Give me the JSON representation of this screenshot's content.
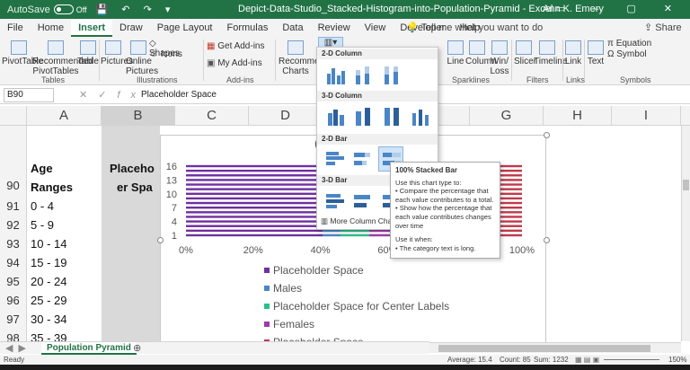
{
  "titlebar": {
    "autosave": "AutoSave",
    "autosave_state": "Off",
    "title": "Depict-Data-Studio_Stacked-Histogram-into-Population-Pyramid  -  Excel",
    "user": "Ann K. Emery"
  },
  "tabs": [
    "File",
    "Home",
    "Insert",
    "Draw",
    "Page Layout",
    "Formulas",
    "Data",
    "Review",
    "View",
    "Developer",
    "Help"
  ],
  "active_tab": "Insert",
  "tellme": "Tell me what you want to do",
  "share": "Share",
  "ribbon": {
    "pivottable": "PivotTable",
    "recommended_pivot": "Recommended PivotTables",
    "table": "Table",
    "tables_group": "Tables",
    "pictures": "Pictures",
    "online_pictures": "Online Pictures",
    "shapes": "Shapes",
    "icons": "Icons",
    "illustrations_group": "Illustrations",
    "get_addins": "Get Add-ins",
    "my_addins": "My Add-ins",
    "addins_group": "Add-ins",
    "recommended_charts": "Recommended Charts",
    "line": "Line",
    "column": "Column",
    "winloss": "Win/ Loss",
    "sparklines_group": "Sparklines",
    "slicer": "Slicer",
    "timeline": "Timeline",
    "filters_group": "Filters",
    "link": "Link",
    "links_group": "Links",
    "text": "Text",
    "equation": "Equation",
    "symbol": "Symbol",
    "symbols_group": "Symbols"
  },
  "formula": {
    "namebox": "B90",
    "fx": "fx",
    "value": "Placeholder Space"
  },
  "columns": [
    "A",
    "B",
    "C",
    "D",
    "E",
    "F",
    "G",
    "H",
    "I"
  ],
  "rows": [
    {
      "num": "90",
      "a": "Ages Ranges"
    },
    {
      "num": "91",
      "a": "0 - 4"
    },
    {
      "num": "92",
      "a": "5 - 9"
    },
    {
      "num": "93",
      "a": "10 - 14"
    },
    {
      "num": "94",
      "a": "15 - 19"
    },
    {
      "num": "95",
      "a": "20 - 24"
    },
    {
      "num": "96",
      "a": "25 - 29"
    },
    {
      "num": "97",
      "a": "30 - 34"
    },
    {
      "num": "98",
      "a": "35 - 39"
    }
  ],
  "header_a1": "Age",
  "header_a2": "Ranges",
  "header_b1": "Placeho",
  "header_b2": "er Spa",
  "chart": {
    "title_partial": "(",
    "y_labels": [
      "16",
      "13",
      "10",
      "7",
      "4",
      "1"
    ],
    "x_labels": [
      "0%",
      "20%",
      "40%",
      "60%",
      "80%",
      "100%"
    ],
    "legend": [
      "Placeholder Space",
      "Males",
      "Placeholder Space for Center Labels",
      "Females",
      "Placeholder Space"
    ],
    "colors": {
      "purple": "#7030a0",
      "blue": "#4a86c6",
      "green": "#2bbf8a",
      "magenta": "#a03aa8",
      "red": "#c0394b"
    }
  },
  "dropdown": {
    "sec_2dcol": "2-D Column",
    "sec_3dcol": "3-D Column",
    "sec_2dbar": "2-D Bar",
    "sec_3dbar": "3-D Bar",
    "more": "More Column Charts..."
  },
  "tooltip": {
    "title": "100% Stacked Bar",
    "line1": "Use this chart type to:",
    "b1": "• Compare the percentage that each value contributes to a total.",
    "b2": "• Show how the percentage that each value contributes changes over time",
    "line2": "Use it when:",
    "b3": "• The category text is long."
  },
  "sheet": {
    "name": "Population Pyramid",
    "add": "⊕"
  },
  "status": {
    "ready": "Ready",
    "average": "Average: 15.4",
    "count": "Count: 85",
    "sum": "Sum: 1232",
    "zoom": "150%"
  }
}
